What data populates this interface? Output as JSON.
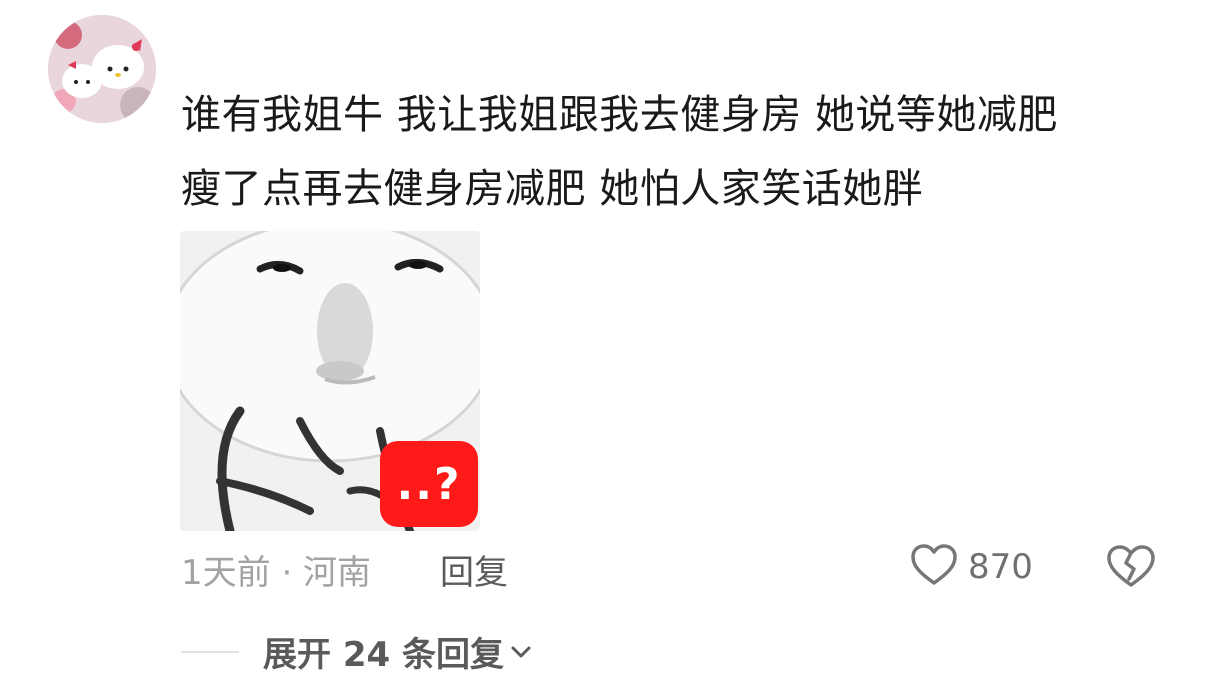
{
  "comment": {
    "text_lines": [
      "谁有我姐牛 我让我姐跟我去健身房 她说等她减肥",
      "瘦了点再去健身房减肥 她怕人家笑话她胖"
    ],
    "sticker_badge": "..?",
    "meta": "1天前 · 河南",
    "reply_label": "回复",
    "like_count": "870",
    "expand_replies": "展开 24 条回复"
  },
  "icons": {
    "like": "heart-outline-icon",
    "dislike": "broken-heart-icon",
    "expand": "chevron-down-icon"
  },
  "colors": {
    "text": "#1a1a1a",
    "meta": "#a3a3a3",
    "badge": "#ff1a1a"
  }
}
